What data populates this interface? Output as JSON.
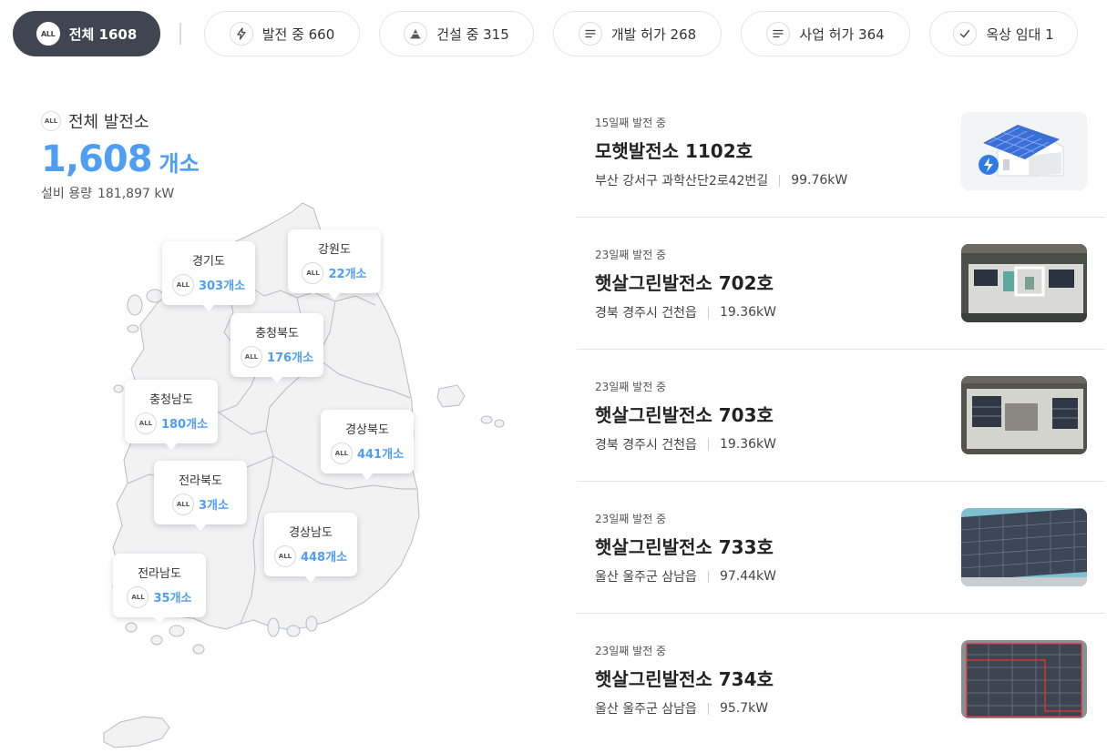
{
  "filters": [
    {
      "label": "전체 1608",
      "icon": "all-badge-icon",
      "badge": "ALL",
      "active": true
    },
    {
      "label": "발전 중 660",
      "icon": "lightning-icon"
    },
    {
      "label": "건설 중 315",
      "icon": "cone-icon"
    },
    {
      "label": "개발 허가 268",
      "icon": "list-lines-icon"
    },
    {
      "label": "사업 허가 364",
      "icon": "list-lines-icon"
    },
    {
      "label": "옥상 임대 1",
      "icon": "check-icon"
    }
  ],
  "summary": {
    "badge": "ALL",
    "title": "전체 발전소",
    "count": "1,608",
    "unit": "개소",
    "capacity_label": "설비 용량",
    "capacity_value": "181,897 kW"
  },
  "regions": [
    {
      "name": "경기도",
      "badge": "ALL",
      "count": "303개소"
    },
    {
      "name": "강원도",
      "badge": "ALL",
      "count": "22개소"
    },
    {
      "name": "충청북도",
      "badge": "ALL",
      "count": "176개소"
    },
    {
      "name": "충청남도",
      "badge": "ALL",
      "count": "180개소"
    },
    {
      "name": "경상북도",
      "badge": "ALL",
      "count": "441개소"
    },
    {
      "name": "전라북도",
      "badge": "ALL",
      "count": "3개소"
    },
    {
      "name": "경상남도",
      "badge": "ALL",
      "count": "448개소"
    },
    {
      "name": "전라남도",
      "badge": "ALL",
      "count": "35개소"
    }
  ],
  "plants": [
    {
      "status": "15일째 발전 중",
      "name": "모햇발전소 1102호",
      "address": "부산 강서구 과학산단2로42번길",
      "capacity": "99.76kW",
      "thumb": "illustration"
    },
    {
      "status": "23일째 발전 중",
      "name": "햇살그린발전소 702호",
      "address": "경북 경주시 건천읍",
      "capacity": "19.36kW",
      "thumb": "aerial"
    },
    {
      "status": "23일째 발전 중",
      "name": "햇살그린발전소 703호",
      "address": "경북 경주시 건천읍",
      "capacity": "19.36kW",
      "thumb": "aerial"
    },
    {
      "status": "23일째 발전 중",
      "name": "햇살그린발전소 733호",
      "address": "울산 울주군 삼남읍",
      "capacity": "97.44kW",
      "thumb": "aerial"
    },
    {
      "status": "23일째 발전 중",
      "name": "햇살그린발전소 734호",
      "address": "울산 울주군 삼남읍",
      "capacity": "95.7kW",
      "thumb": "aerial"
    }
  ],
  "colors": {
    "accent": "#4e9ef4",
    "active_chip": "#3f4651",
    "map_fill": "#f2f2f3",
    "map_stroke": "#b9bbbf"
  }
}
